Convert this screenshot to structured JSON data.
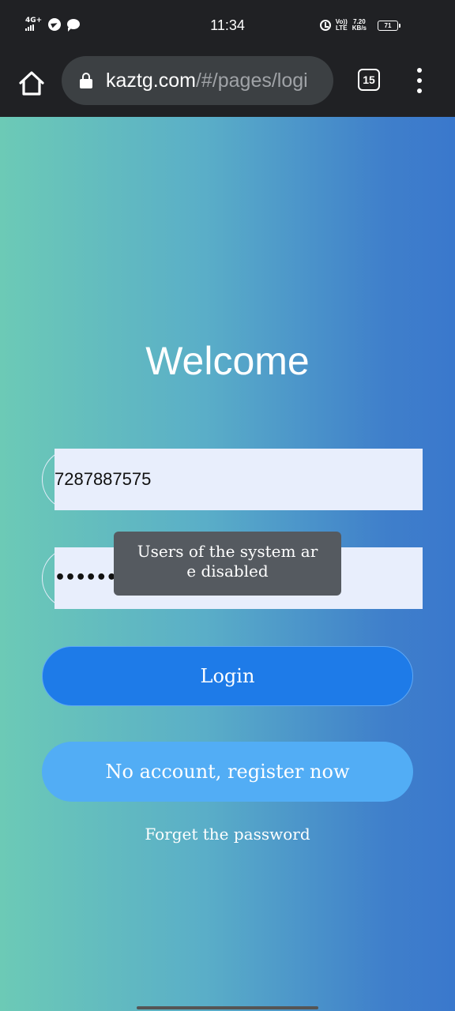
{
  "statusbar": {
    "network": "4G+",
    "time": "11:34",
    "volte_top": "Vo))",
    "volte_bottom": "LTE",
    "speed_value": "7.20",
    "speed_unit": "KB/s",
    "battery": "71"
  },
  "browser": {
    "url_host": "kaztg.com",
    "url_path": "/#/pages/logi",
    "tab_count": "15"
  },
  "page": {
    "title": "Welcome",
    "phone_value": "7287887575",
    "password_mask": "•••••••••••",
    "toast": "Users of the system ar e disabled",
    "toast_line1": "Users of the system ar",
    "toast_line2": "e disabled",
    "login_label": "Login",
    "register_label": "No account, register now",
    "forget_label": "Forget the password"
  },
  "colors": {
    "gradient_left": "#6ccab6",
    "gradient_right": "#3a78cc",
    "login_button": "#1e7be8",
    "register_button": "#52adf5",
    "field_background": "#e8eefc",
    "toast_background": "#555a60"
  }
}
